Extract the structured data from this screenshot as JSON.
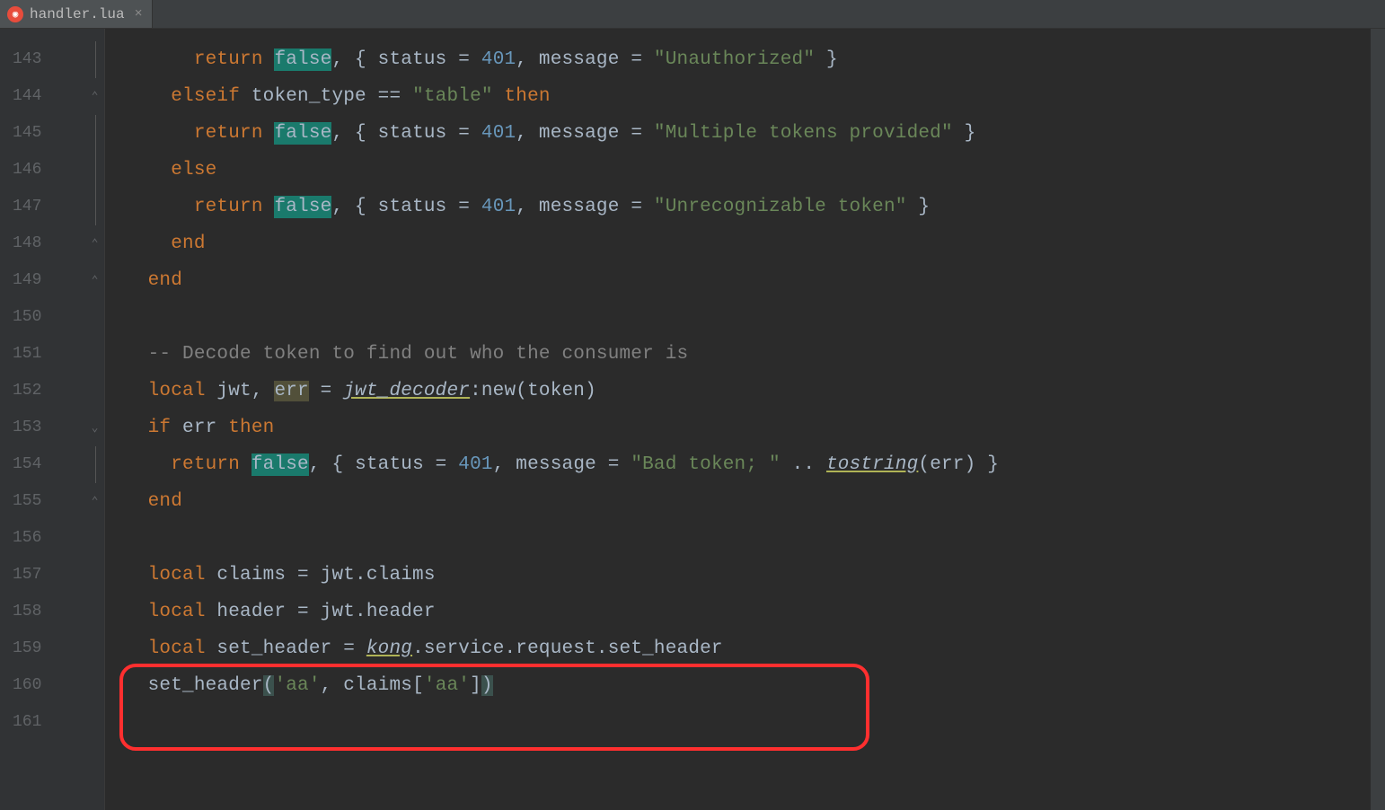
{
  "tab": {
    "label": "handler.lua"
  },
  "lines": {
    "start": 143,
    "numbers": [
      "143",
      "144",
      "145",
      "146",
      "147",
      "148",
      "149",
      "150",
      "151",
      "152",
      "153",
      "154",
      "155",
      "156",
      "157",
      "158",
      "159",
      "160",
      "161"
    ]
  },
  "code": {
    "l143": {
      "ind": "      ",
      "t1": "return ",
      "t2": "false",
      "t3": ", { status = ",
      "t4": "401",
      "t5": ", message = ",
      "t6": "\"Unauthorized\"",
      "t7": " }"
    },
    "l144": {
      "ind": "    ",
      "t1": "elseif ",
      "t2": "token_type == ",
      "t3": "\"table\" ",
      "t4": "then"
    },
    "l145": {
      "ind": "      ",
      "t1": "return ",
      "t2": "false",
      "t3": ", { status = ",
      "t4": "401",
      "t5": ", message = ",
      "t6": "\"Multiple tokens provided\"",
      "t7": " }"
    },
    "l146": {
      "ind": "    ",
      "t1": "else"
    },
    "l147": {
      "ind": "      ",
      "t1": "return ",
      "t2": "false",
      "t3": ", { status = ",
      "t4": "401",
      "t5": ", message = ",
      "t6": "\"Unrecognizable token\"",
      "t7": " }"
    },
    "l148": {
      "ind": "    ",
      "t1": "end"
    },
    "l149": {
      "ind": "  ",
      "t1": "end"
    },
    "l151": {
      "ind": "  ",
      "t1": "-- Decode token to find out who the consumer is"
    },
    "l152": {
      "ind": "  ",
      "t1": "local ",
      "t2": "jwt, ",
      "t3": "err",
      "t4": " = ",
      "t5": "jwt_decoder",
      "t6": ":new(token)"
    },
    "l153": {
      "ind": "  ",
      "t1": "if ",
      "t2": "err ",
      "t3": "then"
    },
    "l154": {
      "ind": "    ",
      "t1": "return ",
      "t2": "false",
      "t3": ", { status = ",
      "t4": "401",
      "t5": ", message = ",
      "t6": "\"Bad token; \"",
      "t7": " .. ",
      "t8": "tostring",
      "t9": "(err) }"
    },
    "l155": {
      "ind": "  ",
      "t1": "end"
    },
    "l157": {
      "ind": "  ",
      "t1": "local ",
      "t2": "claims = jwt.claims"
    },
    "l158": {
      "ind": "  ",
      "t1": "local ",
      "t2": "header = jwt.header"
    },
    "l159": {
      "ind": "  ",
      "t1": "local ",
      "t2": "set_header = ",
      "t3": "kong",
      "t4": ".service.request.set_header"
    },
    "l160": {
      "ind": "  ",
      "t1": "set_header",
      "t2": "(",
      "t3": "'aa'",
      "t4": ", claims[",
      "t5": "'aa'",
      "t6": "]",
      "t7": ")"
    }
  }
}
